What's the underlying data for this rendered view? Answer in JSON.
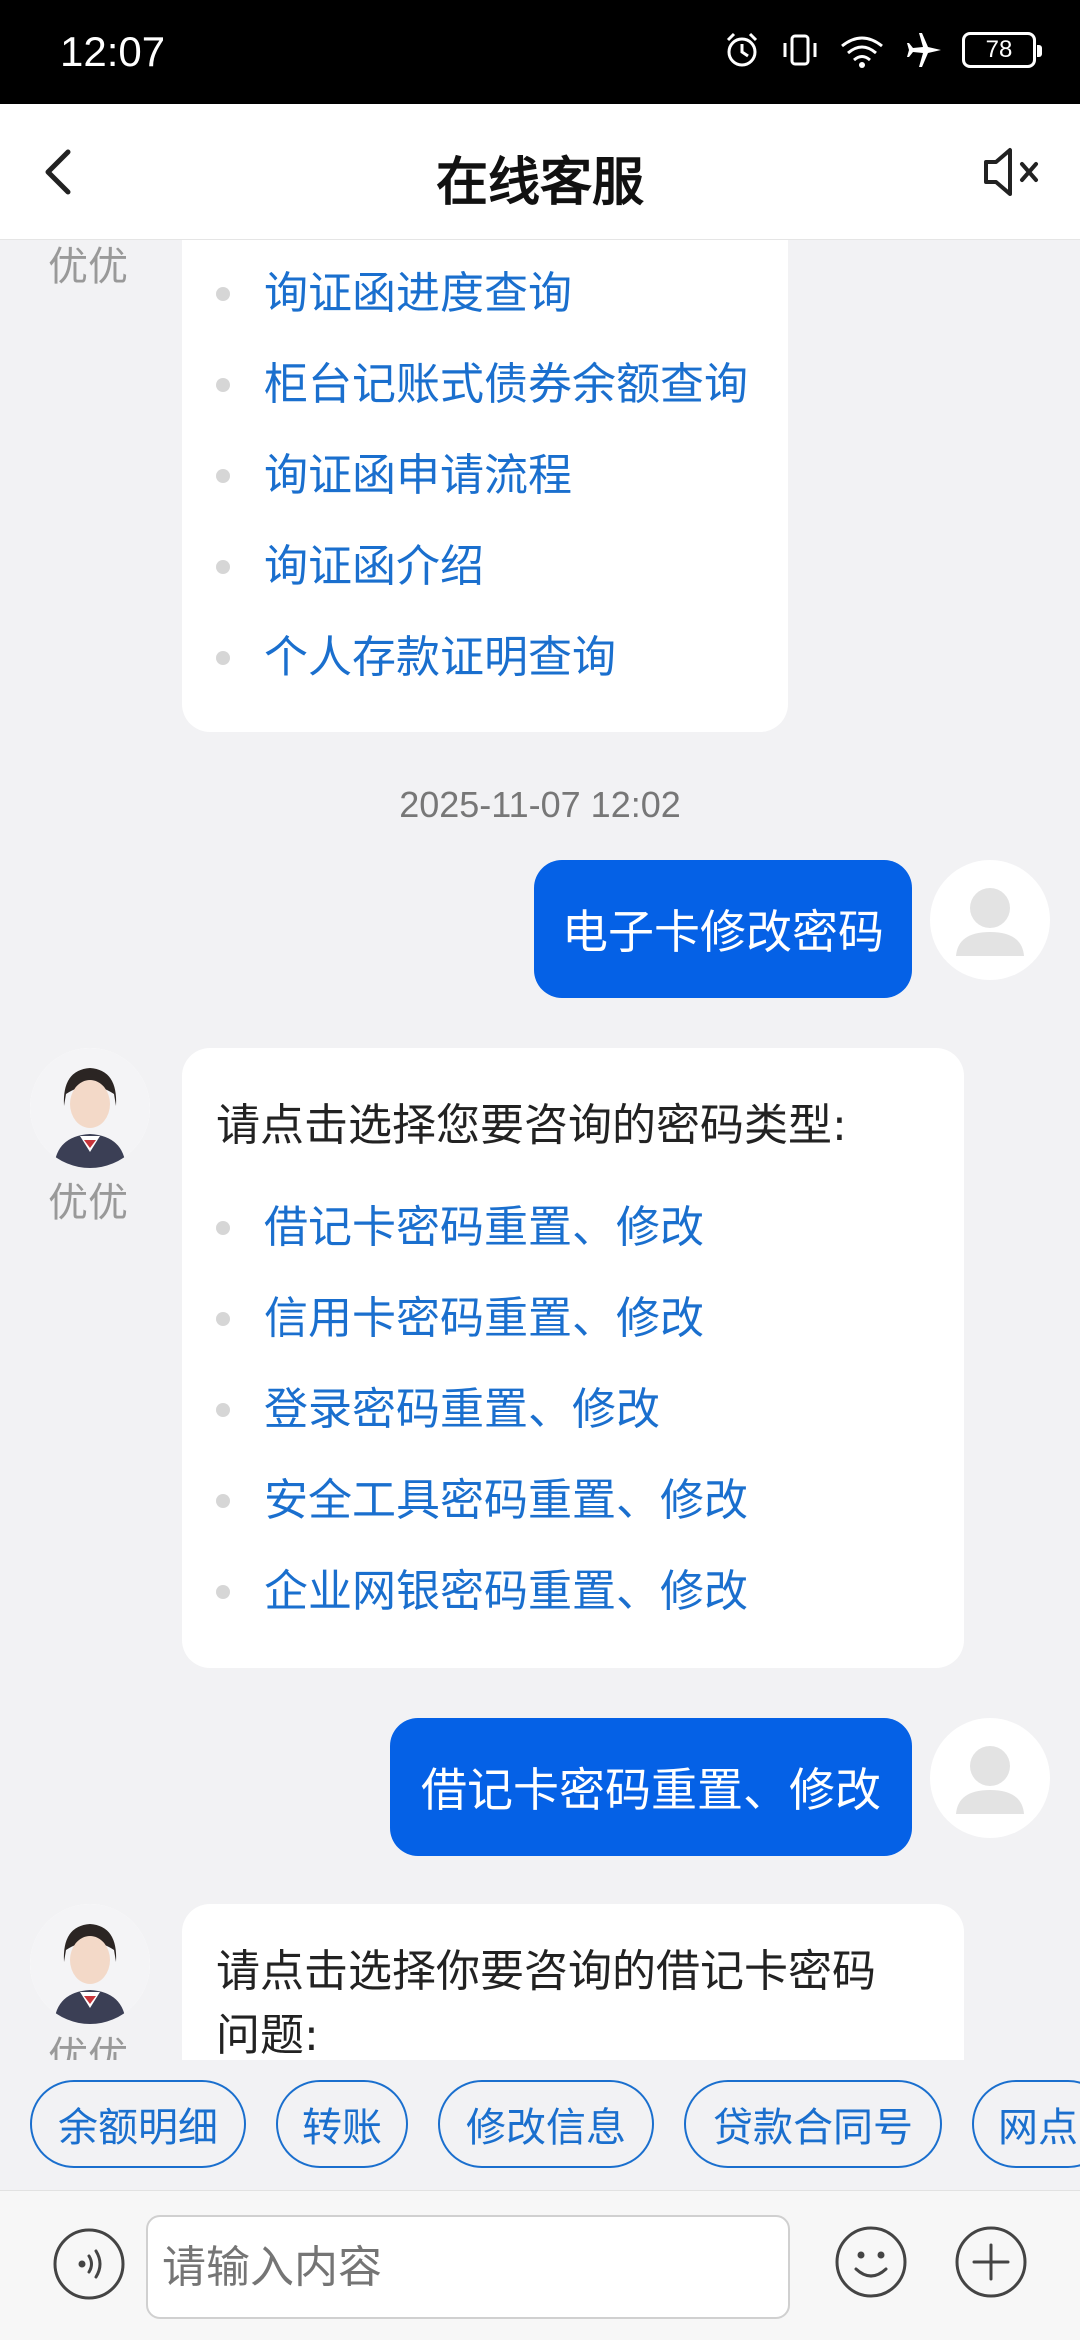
{
  "status_bar": {
    "time": "12:07",
    "battery": "78"
  },
  "header": {
    "title": "在线客服"
  },
  "agent": {
    "name": "优优"
  },
  "messages": {
    "first_agent_options": [
      "询证函进度查询",
      "柜台记账式债券余额查询",
      "询证函申请流程",
      "询证函介绍",
      "个人存款证明查询"
    ],
    "timestamp": "2025-11-07 12:02",
    "user_msg_1": "电子卡修改密码",
    "agent_prompt_2": "请点击选择您要咨询的密码类型:",
    "second_agent_options": [
      "借记卡密码重置、修改",
      "信用卡密码重置、修改",
      "登录密码重置、修改",
      "安全工具密码重置、修改",
      "企业网银密码重置、修改"
    ],
    "user_msg_2": "借记卡密码重置、修改",
    "agent_prompt_3": "请点击选择你要咨询的借记卡密码问题:"
  },
  "quick_replies": [
    "余额明细",
    "转账",
    "修改信息",
    "贷款合同号",
    "网点"
  ],
  "input": {
    "placeholder": "请输入内容"
  },
  "colors": {
    "accent": "#0561e6",
    "link": "#1a6fce",
    "background": "#f2f2f4"
  },
  "icons": [
    "back-arrow-icon",
    "mute-icon",
    "voice-icon",
    "emoji-icon",
    "plus-icon"
  ]
}
